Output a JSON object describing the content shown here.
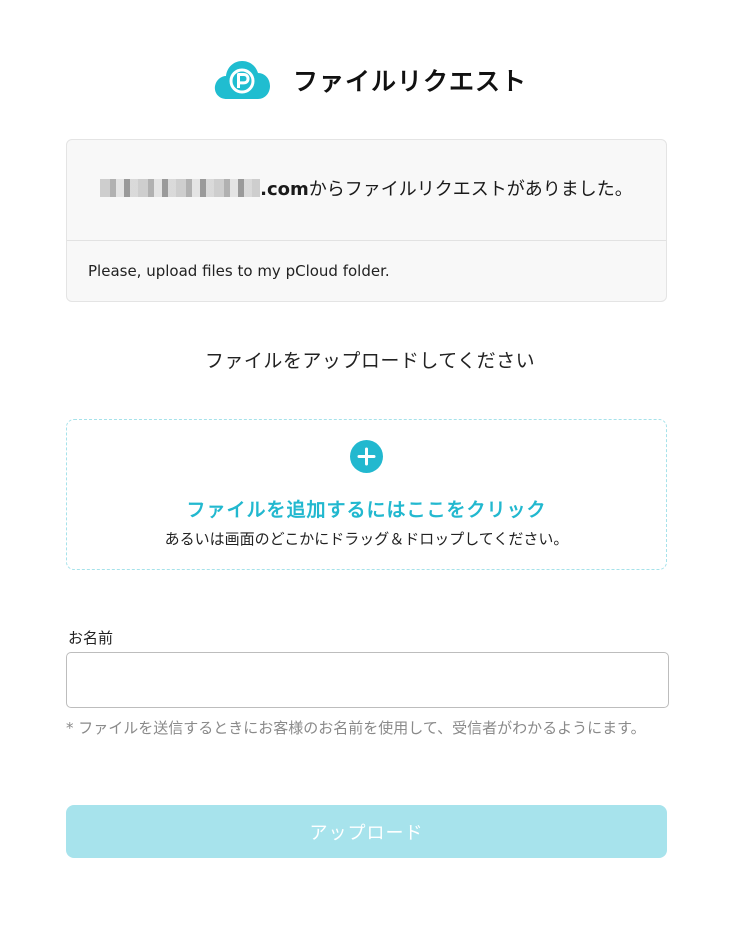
{
  "header": {
    "logo_icon": "pcloud-logo-icon",
    "title": "ファイルリクエスト"
  },
  "request": {
    "email_suffix": ".com",
    "text": "からファイルリクエストがありました。",
    "message": "Please, upload files to my pCloud folder."
  },
  "upload_prompt": "ファイルをアップロードしてください",
  "dropzone": {
    "icon": "plus-circle-icon",
    "link_text": "ファイルを追加するにはここをクリック",
    "subtext": "あるいは画面のどこかにドラッグ＆ドロップしてください。"
  },
  "form": {
    "name_label": "お名前",
    "name_value": "",
    "hint": "* ファイルを送信するときにお客様のお名前を使用して、受信者がわかるようにます。"
  },
  "upload_button": "アップロード",
  "colors": {
    "accent": "#22b8cf",
    "button_disabled": "#a7e3ec",
    "box_bg": "#f8f8f8"
  }
}
